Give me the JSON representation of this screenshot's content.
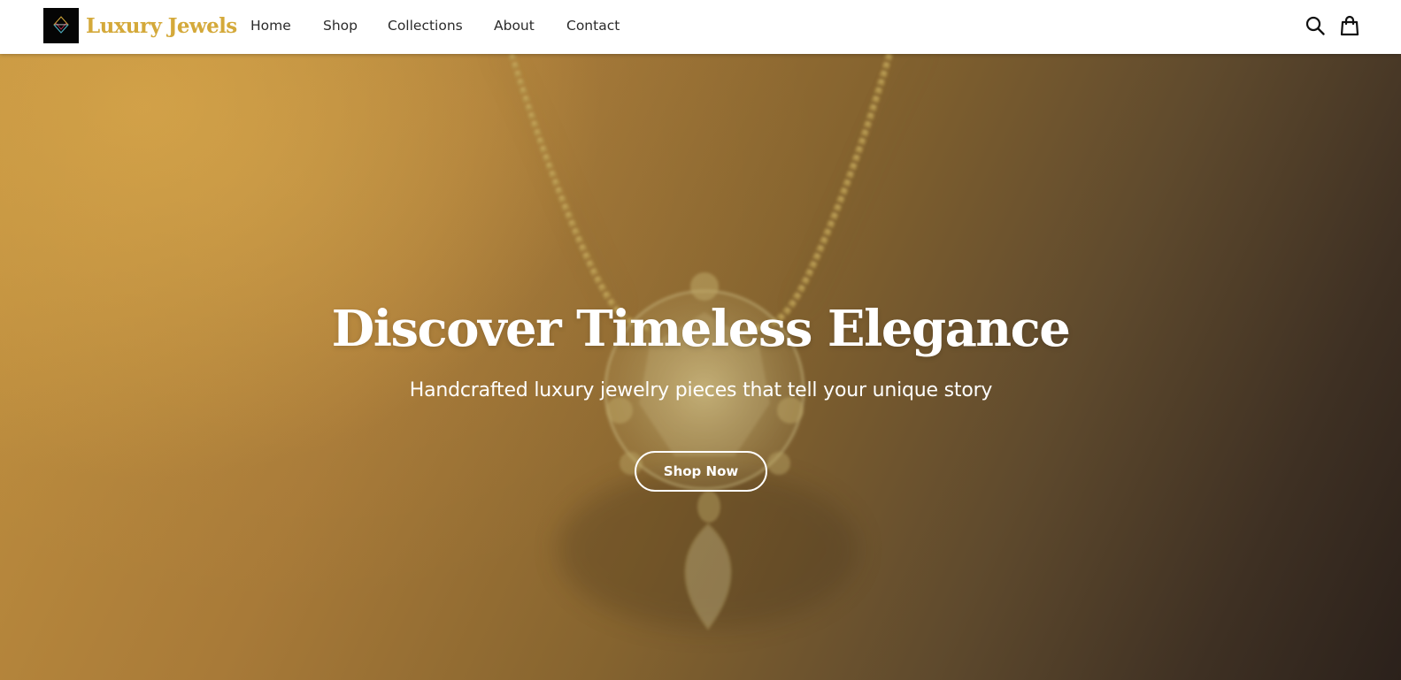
{
  "header": {
    "brand": "Luxury Jewels",
    "logo_icon": "diamond-logo-icon",
    "nav": [
      {
        "label": "Home"
      },
      {
        "label": "Shop"
      },
      {
        "label": "Collections"
      },
      {
        "label": "About"
      },
      {
        "label": "Contact"
      }
    ],
    "icons": [
      "search-icon",
      "shopping-bag-icon"
    ]
  },
  "hero": {
    "title": "Discover Timeless Elegance",
    "subtitle": "Handcrafted luxury jewelry pieces that tell your unique story",
    "cta_label": "Shop Now"
  },
  "colors": {
    "brand": "#d4a93a",
    "header_bg": "#ffffff",
    "hero_light": "#c3923f",
    "hero_dark": "#2b211b",
    "text_on_hero": "#ffffff"
  }
}
